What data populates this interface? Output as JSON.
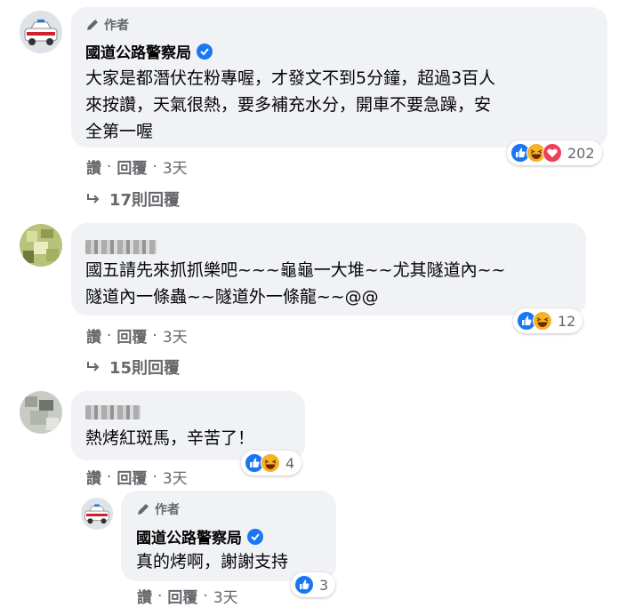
{
  "colors": {
    "bubble": "#f0f2f5",
    "muted": "#65676b",
    "verified": "#1877f2",
    "like": "#1877f2",
    "haha": "#f7b125",
    "love": "#f33e58"
  },
  "comments": [
    {
      "author_badge": "作者",
      "name": "國道公路警察局",
      "verified": true,
      "text": "大家是都潛伏在粉專喔，才發文不到5分鐘，超過3百人\n來按讚，天氣很熱，要多補充水分，開車不要急躁，安\n全第一喔",
      "reactions": [
        "like-icon",
        "haha-icon",
        "love-icon"
      ],
      "reaction_count": "202",
      "like_label": "讚",
      "reply_label": "回覆",
      "time": "3天",
      "replies_label": "17則回覆"
    },
    {
      "name": "",
      "text": "國五請先來抓抓樂吧~~~龜龜一大堆~~尤其隧道內~~\n隧道內一條蟲~~隧道外一條龍~~@@",
      "reactions": [
        "like-icon",
        "haha-icon"
      ],
      "reaction_count": "12",
      "like_label": "讚",
      "reply_label": "回覆",
      "time": "3天",
      "replies_label": "15則回覆"
    },
    {
      "name": "",
      "text": "熱烤紅斑馬，辛苦了！",
      "reactions": [
        "like-icon",
        "haha-icon"
      ],
      "reaction_count": "4",
      "like_label": "讚",
      "reply_label": "回覆",
      "time": "3天"
    }
  ],
  "reply": {
    "author_badge": "作者",
    "name": "國道公路警察局",
    "verified": true,
    "text": "真的烤啊，謝謝支持",
    "reactions": [
      "like-icon"
    ],
    "reaction_count": "3",
    "like_label": "讚",
    "reply_label": "回覆",
    "time": "3天"
  }
}
